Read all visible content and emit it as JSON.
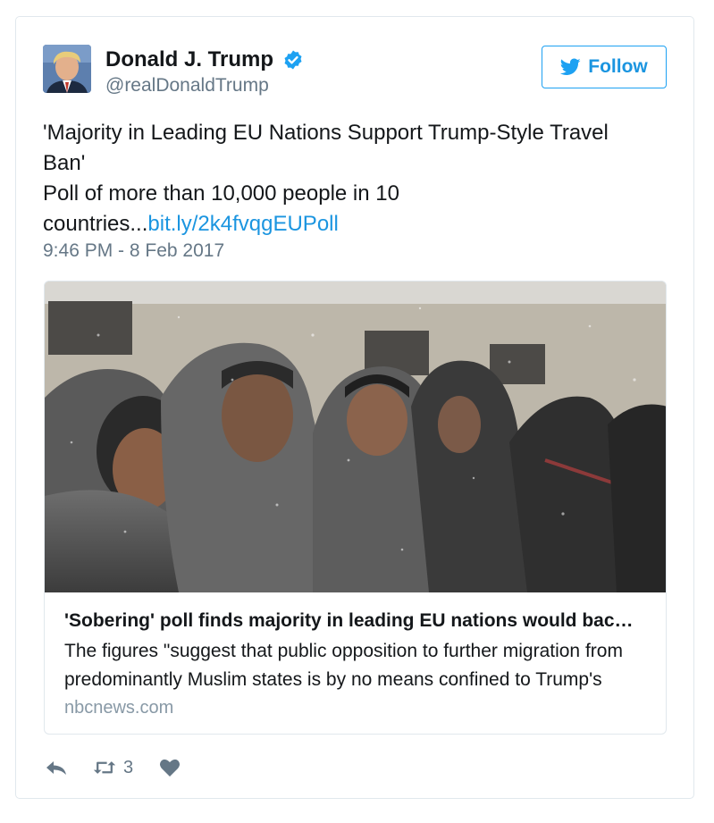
{
  "author": {
    "display_name": "Donald J. Trump",
    "screen_name": "@realDonaldTrump",
    "verified_icon": "verified-badge-icon",
    "avatar_icon": "avatar"
  },
  "follow_button": {
    "label": "Follow",
    "icon": "twitter-bird-icon"
  },
  "tweet": {
    "line1": "'Majority in Leading EU Nations Support Trump-Style Travel Ban'",
    "line2": "Poll of more than 10,000 people in 10 countries...",
    "link": "bit.ly/2k4fvqgEUPoll",
    "timestamp": "9:46 PM - 8 Feb 2017"
  },
  "card": {
    "title": "'Sobering' poll finds majority in leading EU nations would bac…",
    "description": "The figures \"suggest that public opposition to further migration from predominantly Muslim states is by no means confined to Trump's",
    "domain": "nbcnews.com"
  },
  "actions": {
    "reply_icon": "reply-icon",
    "retweet_icon": "retweet-icon",
    "retweet_count": "3",
    "like_icon": "heart-icon"
  },
  "colors": {
    "link": "#1b95e0",
    "muted": "#657786",
    "border": "#e1e8ed",
    "verified": "#1da1f2"
  }
}
